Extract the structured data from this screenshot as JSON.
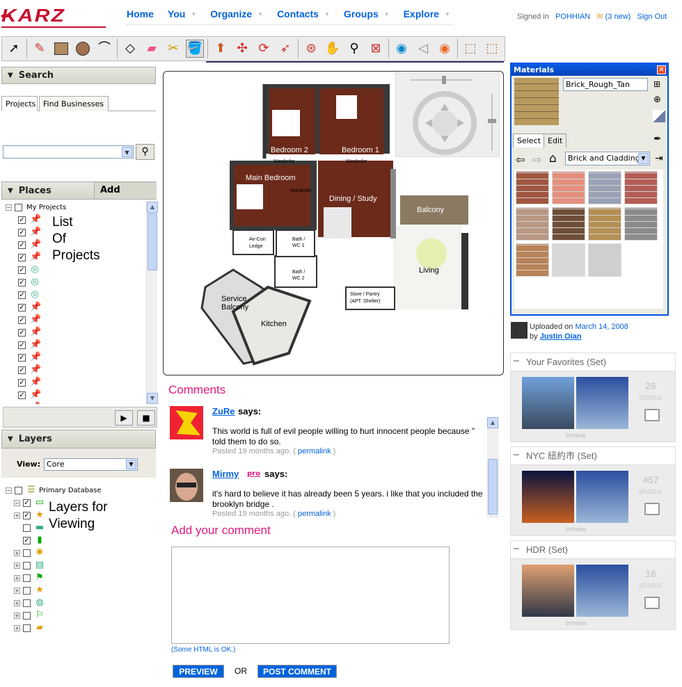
{
  "logo": {
    "text": "KARZ"
  },
  "nav": [
    {
      "label": "Home",
      "dropdown": false
    },
    {
      "label": "You",
      "dropdown": true
    },
    {
      "label": "Organize",
      "dropdown": true
    },
    {
      "label": "Contacts",
      "dropdown": true
    },
    {
      "label": "Groups",
      "dropdown": true
    },
    {
      "label": "Explore",
      "dropdown": true
    }
  ],
  "account": {
    "signed_in": "Signed in",
    "user": "POHHIAN",
    "mail": "(3 new)",
    "sign_out": "Sign Out"
  },
  "left": {
    "search_title": "Search",
    "tabs": [
      "Projects",
      "Find Businesses"
    ],
    "search_value": "",
    "places_title": "Places",
    "add_content": "Add Content",
    "my_projects": "My Projects",
    "big_label": [
      "List",
      "Of",
      "Projects"
    ],
    "layers_title": "Layers",
    "view_label": "View:",
    "view_value": "Core",
    "primary_db": "Primary Database",
    "layers_big": [
      "Layers for",
      "Viewing"
    ]
  },
  "plan": {
    "rooms": [
      "Bedroom 2",
      "Bedroom 1",
      "Wardrobe",
      "Wardrobe",
      "Main Bedroom",
      "Wardrobe",
      "Dining / Study",
      "Balcony",
      "Air-Con",
      "Ledge",
      "Bath /",
      "WC 1",
      "Bath /",
      "WC 2",
      "Living",
      "Service",
      "Balcony",
      "Store / Pantry",
      "(APT. Shelter)",
      "Kitchen"
    ]
  },
  "comments": {
    "title": "Comments",
    "items": [
      {
        "name": "ZuRe",
        "says": "says:",
        "lines": [
          "This world is full of evil people willing to hurt innocent people because \"",
          "told them to do so."
        ],
        "posted": "Posted 19 months ago. (",
        "permalink": "permalink",
        "close": ")"
      },
      {
        "name": "Mirmy",
        "pro": "pro",
        "says": "says:",
        "lines": [
          "it's hard to believe it has already been 5 years. i like that you included the",
          "brooklyn bridge ."
        ],
        "posted": "Posted 19 months ago. (",
        "permalink": "permalink",
        "close": ")"
      }
    ],
    "add_title": "Add your comment",
    "html_ok": "(Some HTML is OK.)",
    "preview": "PREVIEW",
    "or": "OR",
    "post": "POST COMMENT"
  },
  "materials": {
    "title": "Materials",
    "name": "Brick_Rough_Tan",
    "tabs": [
      "Select",
      "Edit"
    ],
    "category": "Brick and Cladding",
    "swatch_colors": [
      "#a0563f",
      "#e58f7d",
      "#9aa2b5",
      "#b45d55",
      "#b89784",
      "#6e4e37",
      "#b58f52",
      "#8b8b8b",
      "#b88257",
      "#d9d9d9",
      "#cfcfcf"
    ],
    "preview_color": "#b89a5f"
  },
  "upload": {
    "prefix": "Uploaded on",
    "date": "March 14, 2008",
    "by": "by",
    "author": "Justin Oian"
  },
  "sets": [
    {
      "title": "Your Favorites (Set)",
      "count": "26",
      "unit": "photos",
      "browse": "browse"
    },
    {
      "title": "NYC 紐約市 (Set)",
      "count": "457",
      "unit": "photos",
      "browse": "browse"
    },
    {
      "title": "HDR (Set)",
      "count": "16",
      "unit": "photos",
      "browse": "browse"
    }
  ]
}
